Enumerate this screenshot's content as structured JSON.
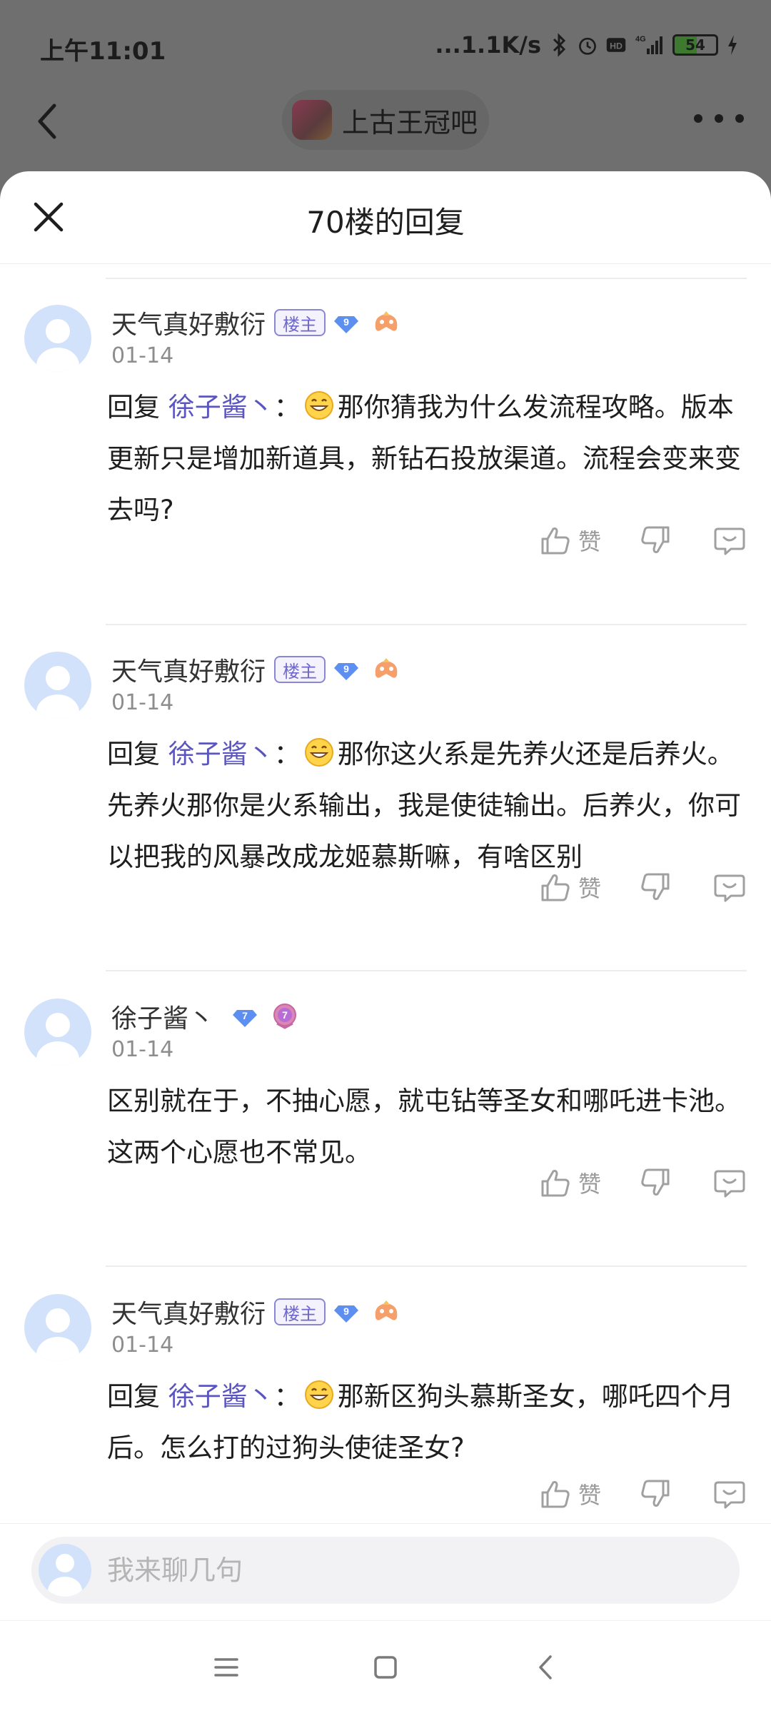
{
  "status_bar": {
    "time": "上午11:01",
    "speed": "...1.1K/s",
    "battery_level": "54",
    "battery_fraction": 0.54
  },
  "nav": {
    "forum_name": "上古王冠吧"
  },
  "sheet": {
    "title": "70楼的回复"
  },
  "replies": [
    {
      "username": "天气真好敷衍",
      "owner_badge": "楼主",
      "level": "9",
      "date": "01-14",
      "reply_prefix": "回复",
      "mention": "徐子酱丶",
      "separator": "：",
      "text": "那你猜我为什么发流程攻略。版本更新只是增加新道具，新钻石投放渠道。流程会变来变去吗?",
      "like_label": "赞"
    },
    {
      "username": "天气真好敷衍",
      "owner_badge": "楼主",
      "level": "9",
      "date": "01-14",
      "reply_prefix": "回复",
      "mention": "徐子酱丶",
      "separator": "：",
      "text": "那你这火系是先养火还是后养火。先养火那你是火系输出，我是使徒输出。后养火，你可以把我的风暴改成龙姬慕斯嘛，有啥区别",
      "like_label": "赞"
    },
    {
      "username": "徐子酱丶",
      "level": "7",
      "medal_level": "7",
      "date": "01-14",
      "text": "区别就在于，不抽心愿，就屯钻等圣女和哪吒进卡池。这两个心愿也不常见。",
      "like_label": "赞"
    },
    {
      "username": "天气真好敷衍",
      "owner_badge": "楼主",
      "level": "9",
      "date": "01-14",
      "reply_prefix": "回复",
      "mention": "徐子酱丶",
      "separator": "：",
      "text": "那新区狗头慕斯圣女，哪吒四个月后。怎么打的过狗头使徒圣女?",
      "like_label": "赞"
    }
  ],
  "input": {
    "placeholder": "我来聊几句"
  },
  "colors": {
    "mention": "#5b55c0",
    "owner_badge": "#6f68cc",
    "level_badge": "#5c8ff0",
    "avatar_bg": "#d3e2fb"
  }
}
